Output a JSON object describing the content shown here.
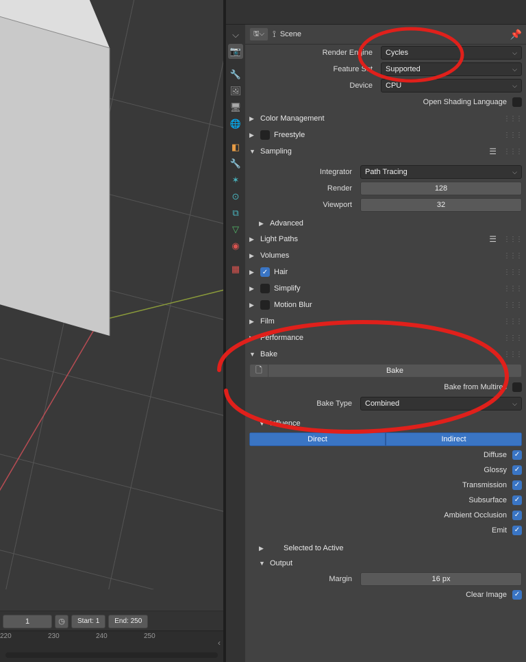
{
  "breadcrumb": {
    "label": "Scene"
  },
  "render_engine": {
    "label": "Render Engine",
    "value": "Cycles"
  },
  "feature_set": {
    "label": "Feature Set",
    "value": "Supported"
  },
  "device": {
    "label": "Device",
    "value": "CPU"
  },
  "osl": {
    "label": "Open Shading Language"
  },
  "panels": {
    "color_management": "Color Management",
    "freestyle": "Freestyle",
    "sampling": "Sampling",
    "light_paths": "Light Paths",
    "volumes": "Volumes",
    "hair": "Hair",
    "simplify": "Simplify",
    "motion_blur": "Motion Blur",
    "film": "Film",
    "performance": "Performance",
    "bake": "Bake",
    "selected_to_active": "Selected to Active",
    "output": "Output"
  },
  "sampling": {
    "integrator": {
      "label": "Integrator",
      "value": "Path Tracing"
    },
    "render": {
      "label": "Render",
      "value": "128"
    },
    "viewport": {
      "label": "Viewport",
      "value": "32"
    },
    "advanced": "Advanced"
  },
  "bake": {
    "button": "Bake",
    "from_multires": "Bake from Multires",
    "type": {
      "label": "Bake Type",
      "value": "Combined"
    },
    "influence": "Influence",
    "direct": "Direct",
    "indirect": "Indirect",
    "passes": {
      "diffuse": "Diffuse",
      "glossy": "Glossy",
      "transmission": "Transmission",
      "subsurface": "Subsurface",
      "ao": "Ambient Occlusion",
      "emit": "Emit"
    }
  },
  "output": {
    "margin": {
      "label": "Margin",
      "value": "16 px"
    },
    "clear": "Clear Image"
  },
  "timeline": {
    "current": "1",
    "start_label": "Start:",
    "start": "1",
    "end_label": "End:",
    "end": "250",
    "ticks": [
      "220",
      "230",
      "240",
      "250"
    ]
  }
}
